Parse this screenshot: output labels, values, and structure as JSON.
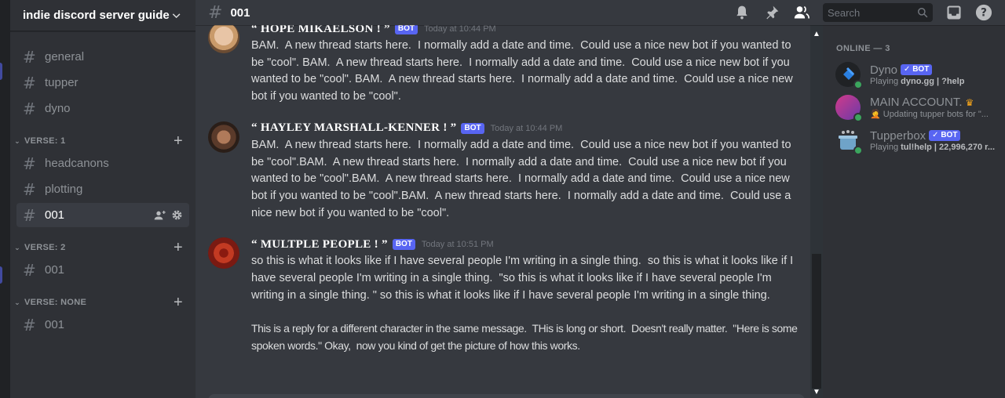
{
  "server": {
    "name": "indie discord server guide"
  },
  "sidebar": {
    "top_channels": [
      {
        "name": "general"
      },
      {
        "name": "tupper"
      },
      {
        "name": "dyno"
      }
    ],
    "categories": [
      {
        "name": "VERSE: 1",
        "channels": [
          {
            "name": "headcanons"
          },
          {
            "name": "plotting"
          },
          {
            "name": "001",
            "active": true
          }
        ]
      },
      {
        "name": "VERSE: 2",
        "channels": [
          {
            "name": "001"
          }
        ]
      },
      {
        "name": "VERSE: NONE",
        "channels": [
          {
            "name": "001"
          }
        ]
      }
    ]
  },
  "topbar": {
    "channel": "001",
    "search_placeholder": "Search",
    "icons": [
      "bell-icon",
      "pin-icon",
      "members-icon",
      "inbox-icon",
      "help-icon"
    ]
  },
  "messages": [
    {
      "author": "“ HOPE MIKAELSON ! ”",
      "badge": "BOT",
      "timestamp": "Today at 10:44 PM",
      "text": "BAM.  A new thread starts here.  I normally add a date and time.  Could use a nice new bot if you wanted to be \"cool\". BAM.  A new thread starts here.  I normally add a date and time.  Could use a nice new bot if you wanted to be \"cool\". BAM.  A new thread starts here.  I normally add a date and time.  Could use a nice new bot if you wanted to be \"cool\"."
    },
    {
      "author": "“ HAYLEY MARSHALL-KENNER ! ”",
      "badge": "BOT",
      "timestamp": "Today at 10:44 PM",
      "text": "BAM.  A new thread starts here.  I normally add a date and time.  Could use a nice new bot if you wanted to be \"cool\".BAM.  A new thread starts here.  I normally add a date and time.  Could use a nice new bot if you wanted to be \"cool\".BAM.  A new thread starts here.  I normally add a date and time.  Could use a nice new bot if you wanted to be \"cool\".BAM.  A new thread starts here.  I normally add a date and time.  Could use a nice new bot if you wanted to be \"cool\"."
    },
    {
      "author": "“ MULTPLE PEOPLE ! ”",
      "badge": "BOT",
      "timestamp": "Today at 10:51 PM",
      "text": "so this is what it looks like if I have several people I'm writing in a single thing.  so this is what it looks like if I have several people I'm writing in a single thing.  \"so this is what it looks like if I have several people I'm writing in a single thing. \" so this is what it looks like if I have several people I'm writing in a single thing.",
      "text2": "This is a reply for a different character in the same message.  THis is long or short.  Doesn't really matter.  \"Here is some spoken words.\" Okay,  now you kind of get the picture of how this works."
    }
  ],
  "members": {
    "group_label": "ONLINE — 3",
    "list": [
      {
        "name": "Dyno",
        "badge": "✓ BOT",
        "activity_prefix": "Playing ",
        "activity": "dyno.gg | ?help"
      },
      {
        "name": "MAIN ACCOUNT.",
        "crown": "♛",
        "activity_prefix": "🤦 ",
        "activity": "Updating tupper bots for \"..."
      },
      {
        "name": "Tupperbox",
        "badge": "✓ BOT",
        "activity_prefix": "Playing ",
        "activity": "tul!help | 22,996,270 r..."
      }
    ]
  },
  "colors": {
    "accent": "#5865f2",
    "online": "#3ba55d",
    "bg": "#36393f",
    "sidebar": "#2f3136"
  }
}
